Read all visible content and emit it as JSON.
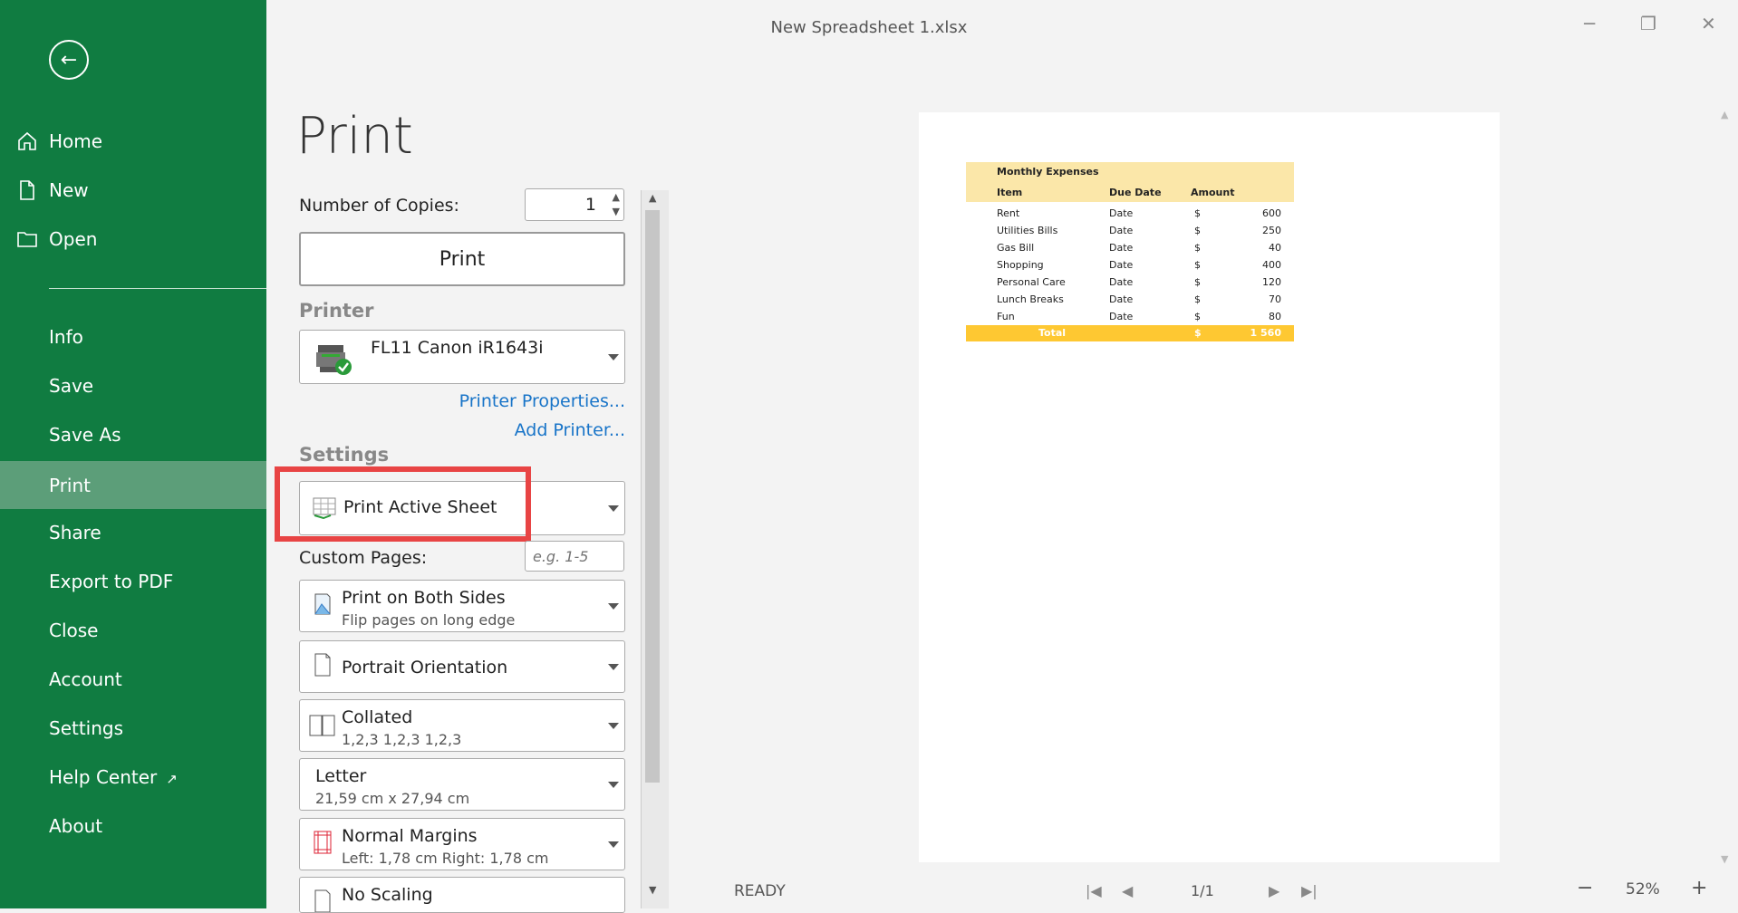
{
  "window": {
    "title": "New Spreadsheet 1.xlsx",
    "minimize": "─",
    "restore": "❐",
    "close": "✕"
  },
  "sidebar": {
    "back": "←",
    "items": [
      {
        "label": "Home",
        "icon": "home-icon"
      },
      {
        "label": "New",
        "icon": "file-icon"
      },
      {
        "label": "Open",
        "icon": "folder-icon"
      },
      {
        "label": "Info"
      },
      {
        "label": "Save"
      },
      {
        "label": "Save As"
      },
      {
        "label": "Print",
        "active": true
      },
      {
        "label": "Share"
      },
      {
        "label": "Export to PDF"
      },
      {
        "label": "Close"
      },
      {
        "label": "Account"
      },
      {
        "label": "Settings"
      },
      {
        "label": "Help Center",
        "icon": "external-link-icon"
      },
      {
        "label": "About"
      }
    ],
    "external_glyph": "↗"
  },
  "print": {
    "heading": "Print",
    "copies_label": "Number of Copies:",
    "copies_value": "1",
    "print_button": "Print",
    "printer_section": "Printer",
    "printer_name": "FL11 Canon iR1643i",
    "printer_properties": "Printer Properties...",
    "add_printer": "Add Printer...",
    "settings_section": "Settings",
    "print_what": "Print Active Sheet",
    "custom_pages_label": "Custom Pages:",
    "custom_pages_placeholder": "e.g. 1-5",
    "sides_title": "Print on Both Sides",
    "sides_sub": "Flip pages on long edge",
    "orientation": "Portrait Orientation",
    "collate_title": "Collated",
    "collate_sub": "1,2,3 1,2,3 1,2,3",
    "paper_title": "Letter",
    "paper_sub": "21,59 cm x 27,94 cm",
    "margins_title": "Normal Margins",
    "margins_sub": "Left: 1,78 cm  Right: 1,78 cm",
    "scaling_title": "No Scaling"
  },
  "preview": {
    "sheet_title": "Monthly Expenses",
    "headers": [
      "Item",
      "Due Date",
      "Amount"
    ],
    "rows": [
      {
        "item": "Rent",
        "due": "Date",
        "cur": "$",
        "amount": "600"
      },
      {
        "item": "Utilities Bills",
        "due": "Date",
        "cur": "$",
        "amount": "250"
      },
      {
        "item": "Gas Bill",
        "due": "Date",
        "cur": "$",
        "amount": "40"
      },
      {
        "item": "Shopping",
        "due": "Date",
        "cur": "$",
        "amount": "400"
      },
      {
        "item": "Personal Care",
        "due": "Date",
        "cur": "$",
        "amount": "120"
      },
      {
        "item": "Lunch Breaks",
        "due": "Date",
        "cur": "$",
        "amount": "70"
      },
      {
        "item": "Fun",
        "due": "Date",
        "cur": "$",
        "amount": "80"
      }
    ],
    "total_label": "Total",
    "total_cur": "$",
    "total_amount": "1 560"
  },
  "status": {
    "state": "READY",
    "page": "1/1",
    "zoom": "52%",
    "zoom_out": "−",
    "zoom_in": "+"
  },
  "colors": {
    "sidebar": "#107c41",
    "sidebar_active": "#5c9e79",
    "link": "#1874c8",
    "highlight": "#e84444",
    "sheet_header": "#fbe7a9",
    "sheet_total": "#fec832"
  }
}
